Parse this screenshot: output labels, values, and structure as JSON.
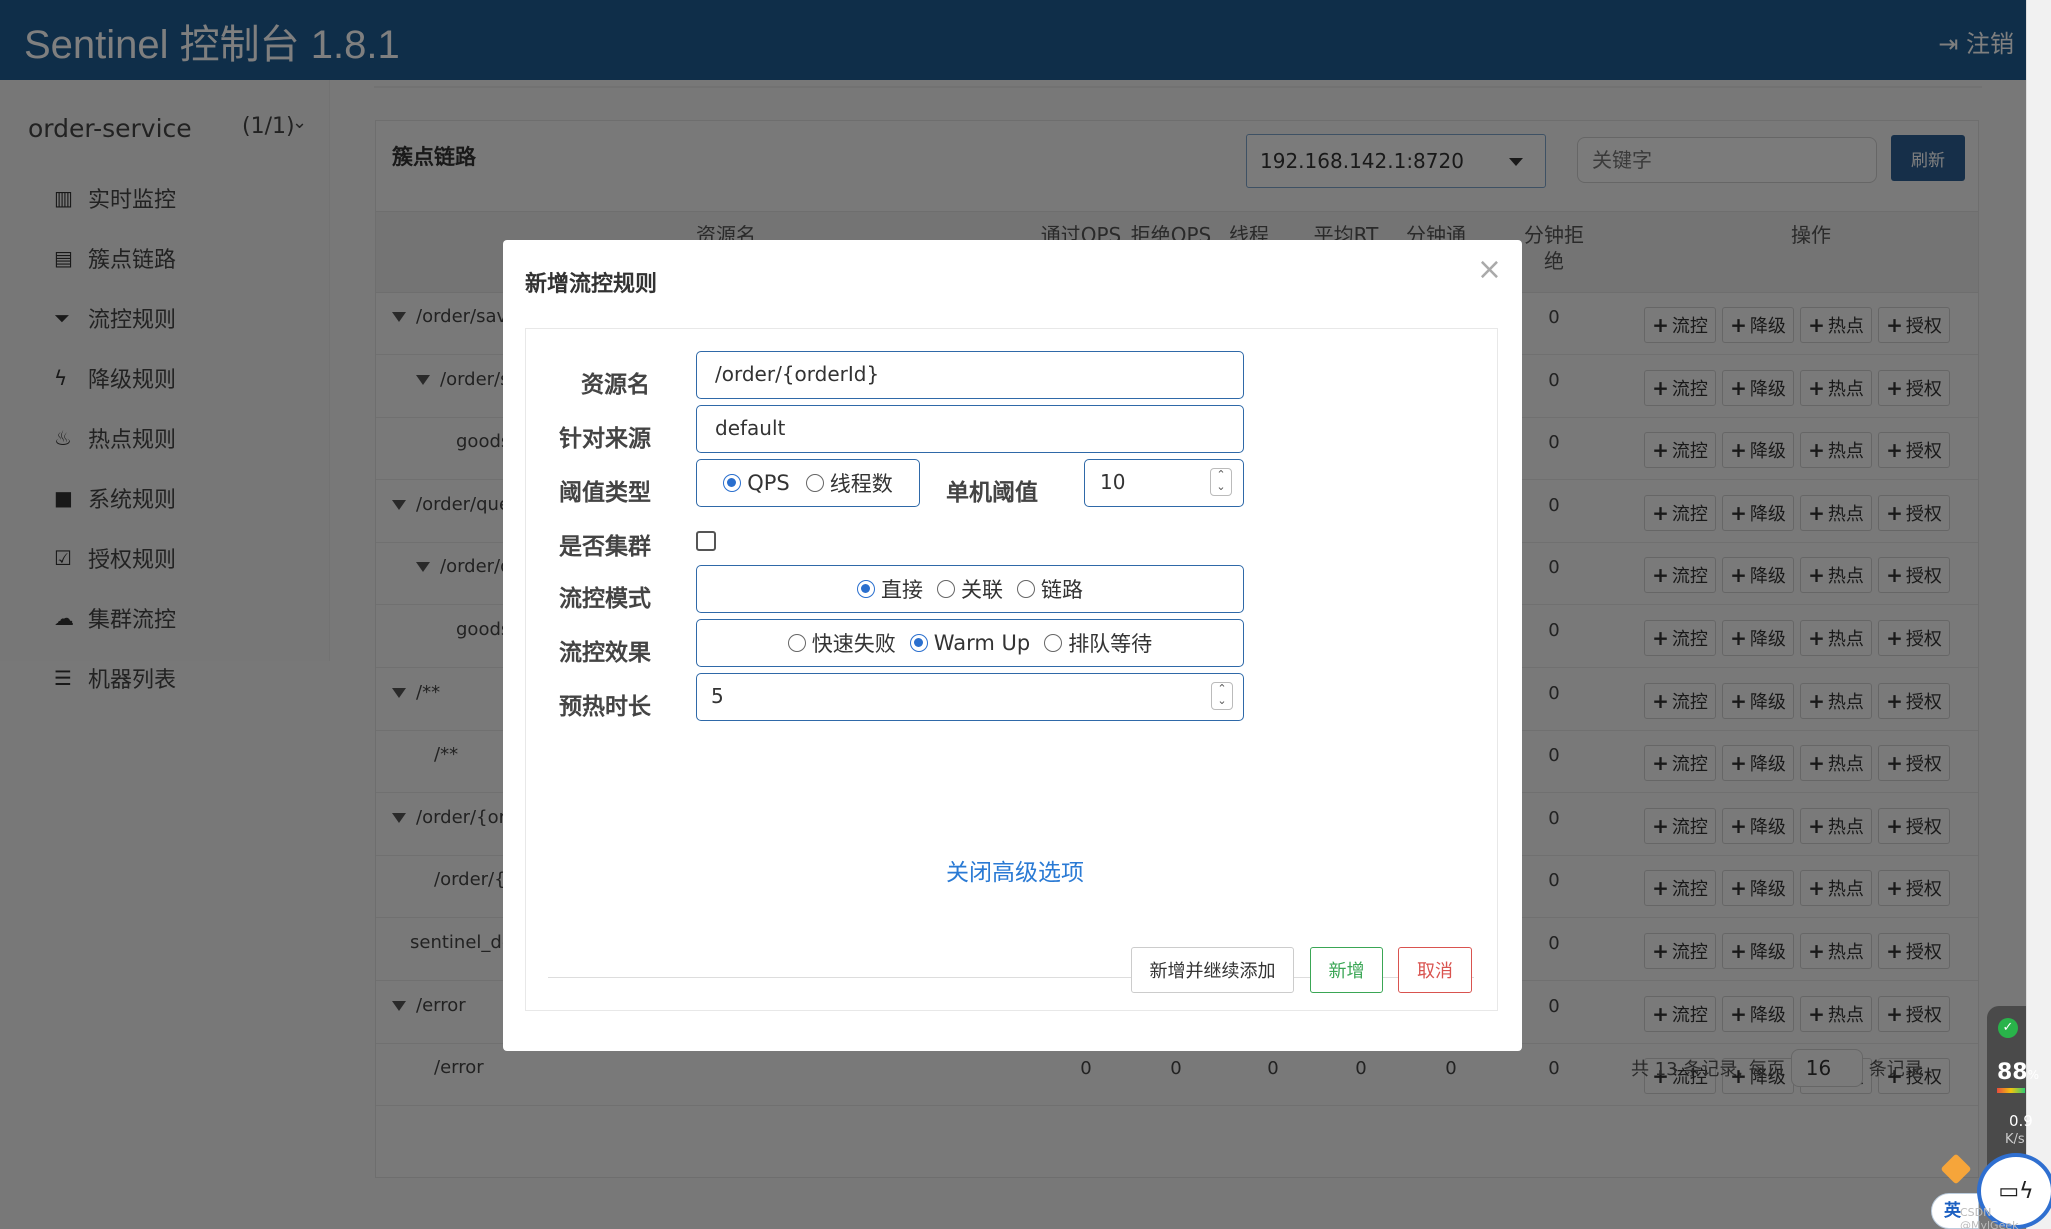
{
  "header": {
    "title": "Sentinel 控制台 1.8.1",
    "logout_label": "注销"
  },
  "sidebar": {
    "app_name": "order-service",
    "app_count": "(1/1)",
    "items": [
      {
        "label": "实时监控",
        "icon": "bar-chart-icon"
      },
      {
        "label": "簇点链路",
        "icon": "list-alt-icon"
      },
      {
        "label": "流控规则",
        "icon": "filter-icon"
      },
      {
        "label": "降级规则",
        "icon": "flash-icon"
      },
      {
        "label": "热点规则",
        "icon": "fire-icon"
      },
      {
        "label": "系统规则",
        "icon": "lock-icon"
      },
      {
        "label": "授权规则",
        "icon": "check-square-icon"
      },
      {
        "label": "集群流控",
        "icon": "cloud-icon"
      },
      {
        "label": "机器列表",
        "icon": "th-list-icon"
      }
    ]
  },
  "panel": {
    "title": "簇点链路",
    "machine": "192.168.142.1:8720",
    "keyword_placeholder": "关键字",
    "refresh_label": "刷新"
  },
  "table": {
    "columns": [
      "资源名",
      "通过QPS",
      "拒绝QPS",
      "线程",
      "平均RT",
      "分钟通",
      "分钟拒绝",
      "操作"
    ],
    "op_labels": [
      "流控",
      "降级",
      "热点",
      "授权"
    ],
    "rows": [
      {
        "name": "/order/save",
        "rejected_min": "0"
      },
      {
        "name": "/order/save",
        "rejected_min": "0"
      },
      {
        "name": "goods",
        "rejected_min": "0"
      },
      {
        "name": "/order/query",
        "rejected_min": "0"
      },
      {
        "name": "/order/query",
        "rejected_min": "0"
      },
      {
        "name": "goods",
        "rejected_min": "0"
      },
      {
        "name": "/**",
        "rejected_min": "0"
      },
      {
        "name": "/**",
        "rejected_min": "0"
      },
      {
        "name": "/order/{orderId}",
        "rejected_min": "0"
      },
      {
        "name": "/order/{orderId}",
        "rejected_min": "0"
      },
      {
        "name": "sentinel_default_context",
        "rejected_min": "0"
      },
      {
        "name": "/error",
        "rejected_min": "0"
      },
      {
        "name": "/error",
        "pass_qps": "0",
        "block_qps": "0",
        "threads": "0",
        "avg_rt": "0",
        "pass_min": "0",
        "rejected_min": "0"
      }
    ]
  },
  "pager": {
    "prefix": "共 13 条记录, 每页",
    "page_size": "16",
    "suffix": "条记录"
  },
  "modal": {
    "title": "新增流控规则",
    "resource_label": "资源名",
    "resource_value": "/order/{orderId}",
    "origin_label": "针对来源",
    "origin_value": "default",
    "grade_label": "阈值类型",
    "grade_options": [
      "QPS",
      "线程数"
    ],
    "threshold_label": "单机阈值",
    "threshold_value": "10",
    "cluster_label": "是否集群",
    "strategy_label": "流控模式",
    "strategy_options": [
      "直接",
      "关联",
      "链路"
    ],
    "effect_label": "流控效果",
    "effect_options": [
      "快速失败",
      "Warm Up",
      "排队等待"
    ],
    "warmup_label": "预热时长",
    "warmup_value": "5",
    "advanced_link": "关闭高级选项",
    "btn_add_continue": "新增并继续添加",
    "btn_add": "新增",
    "btn_cancel": "取消"
  },
  "widgets": {
    "cpu": "88",
    "cpu_unit": "%",
    "speed": "0.9",
    "speed_unit": "K/s",
    "ime": "英",
    "watermark": "CSDN @MylGeek"
  },
  "colors": {
    "header": "#1f5d92",
    "primary": "#2c5f92",
    "success": "#3aa655",
    "danger": "#d9534f",
    "link": "#2a7ad4"
  }
}
